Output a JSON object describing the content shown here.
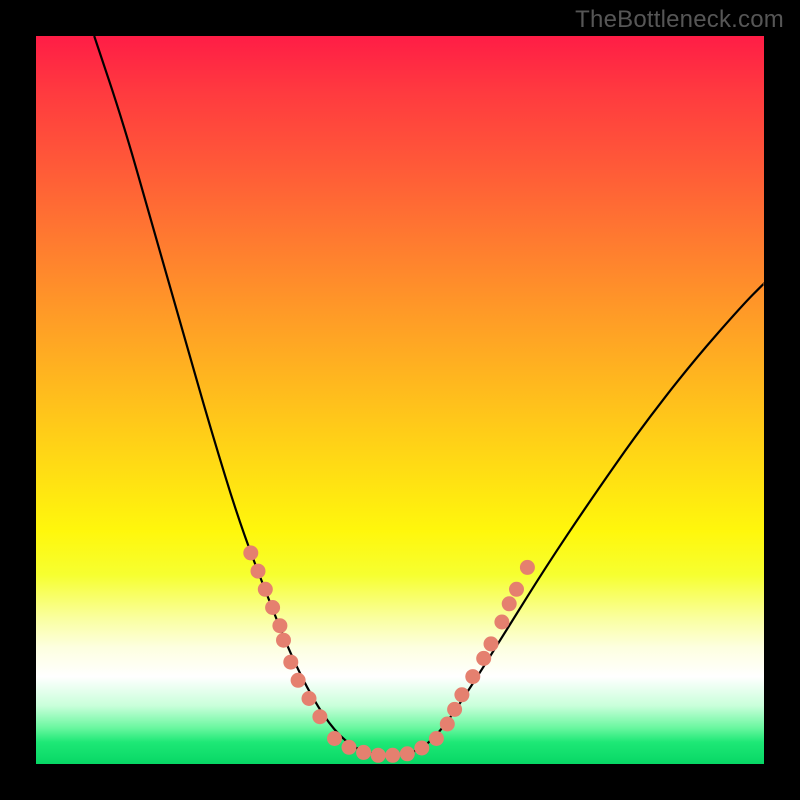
{
  "watermark": "TheBottleneck.com",
  "chart_data": {
    "type": "line",
    "title": "",
    "xlabel": "",
    "ylabel": "",
    "xlim": [
      0,
      100
    ],
    "ylim": [
      0,
      100
    ],
    "grid": false,
    "curve": [
      {
        "x": 8.0,
        "y": 100.0
      },
      {
        "x": 12.0,
        "y": 88.0
      },
      {
        "x": 16.0,
        "y": 74.0
      },
      {
        "x": 20.0,
        "y": 60.0
      },
      {
        "x": 24.0,
        "y": 46.0
      },
      {
        "x": 28.0,
        "y": 33.0
      },
      {
        "x": 32.0,
        "y": 22.5
      },
      {
        "x": 35.0,
        "y": 15.0
      },
      {
        "x": 38.0,
        "y": 9.0
      },
      {
        "x": 41.0,
        "y": 4.5
      },
      {
        "x": 44.0,
        "y": 2.0
      },
      {
        "x": 47.0,
        "y": 1.2
      },
      {
        "x": 50.0,
        "y": 1.2
      },
      {
        "x": 53.0,
        "y": 2.0
      },
      {
        "x": 56.0,
        "y": 5.0
      },
      {
        "x": 60.0,
        "y": 11.0
      },
      {
        "x": 65.0,
        "y": 19.0
      },
      {
        "x": 70.0,
        "y": 27.0
      },
      {
        "x": 76.0,
        "y": 36.0
      },
      {
        "x": 83.0,
        "y": 46.0
      },
      {
        "x": 90.0,
        "y": 55.0
      },
      {
        "x": 97.0,
        "y": 63.0
      },
      {
        "x": 100.0,
        "y": 66.0
      }
    ],
    "points_left": [
      {
        "x": 29.5,
        "y": 29.0
      },
      {
        "x": 30.5,
        "y": 26.5
      },
      {
        "x": 31.5,
        "y": 24.0
      },
      {
        "x": 32.5,
        "y": 21.5
      },
      {
        "x": 33.5,
        "y": 19.0
      },
      {
        "x": 34.0,
        "y": 17.0
      },
      {
        "x": 35.0,
        "y": 14.0
      },
      {
        "x": 36.0,
        "y": 11.5
      },
      {
        "x": 37.5,
        "y": 9.0
      },
      {
        "x": 39.0,
        "y": 6.5
      }
    ],
    "points_bottom": [
      {
        "x": 41.0,
        "y": 3.5
      },
      {
        "x": 43.0,
        "y": 2.3
      },
      {
        "x": 45.0,
        "y": 1.6
      },
      {
        "x": 47.0,
        "y": 1.2
      },
      {
        "x": 49.0,
        "y": 1.2
      },
      {
        "x": 51.0,
        "y": 1.4
      },
      {
        "x": 53.0,
        "y": 2.2
      },
      {
        "x": 55.0,
        "y": 3.5
      }
    ],
    "points_right": [
      {
        "x": 56.5,
        "y": 5.5
      },
      {
        "x": 57.5,
        "y": 7.5
      },
      {
        "x": 58.5,
        "y": 9.5
      },
      {
        "x": 60.0,
        "y": 12.0
      },
      {
        "x": 61.5,
        "y": 14.5
      },
      {
        "x": 62.5,
        "y": 16.5
      },
      {
        "x": 64.0,
        "y": 19.5
      },
      {
        "x": 65.0,
        "y": 22.0
      },
      {
        "x": 66.0,
        "y": 24.0
      },
      {
        "x": 67.5,
        "y": 27.0
      }
    ],
    "point_radius": 7.5,
    "colors": {
      "curve": "#000000",
      "points": "#e5806f",
      "bg_top": "#ff1d46",
      "bg_bottom": "#07d765"
    }
  }
}
